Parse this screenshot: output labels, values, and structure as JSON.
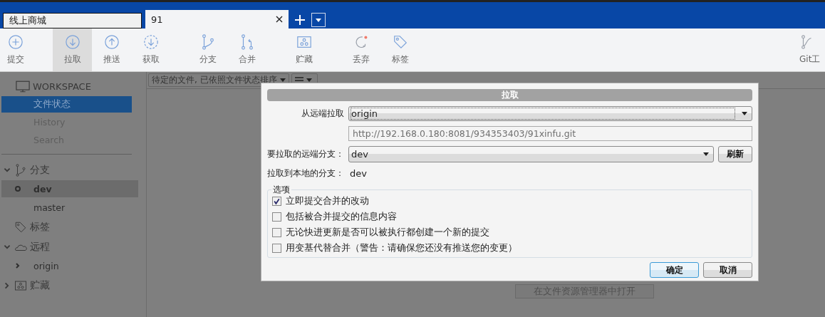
{
  "tabs": [
    {
      "label": "线上商城",
      "selected": false
    },
    {
      "label": "91",
      "selected": true
    }
  ],
  "toolbar": [
    {
      "label": "提交",
      "selected": false
    },
    {
      "label": "拉取",
      "selected": true
    },
    {
      "label": "推送",
      "selected": false
    },
    {
      "label": "获取",
      "selected": false
    },
    {
      "label": "分支",
      "selected": false
    },
    {
      "label": "合并",
      "selected": false
    },
    {
      "label": "贮藏",
      "selected": false
    },
    {
      "label": "丢弃",
      "selected": false
    },
    {
      "label": "标签",
      "selected": false
    }
  ],
  "toolbar_right": {
    "label": "Git工"
  },
  "sidebar": {
    "workspace": {
      "title": "WORKSPACE",
      "items": [
        {
          "label": "文件状态",
          "selected": true
        },
        {
          "label": "History",
          "selected": false
        },
        {
          "label": "Search",
          "selected": false
        }
      ]
    },
    "sections": [
      {
        "title": "分支",
        "expanded": true,
        "items": [
          {
            "label": "dev",
            "selected": true
          },
          {
            "label": "master",
            "selected": false
          }
        ]
      },
      {
        "title": "标签"
      },
      {
        "title": "远程",
        "expanded": true,
        "items": [
          {
            "label": "origin",
            "selected": false,
            "expanded": false
          }
        ]
      },
      {
        "title": "贮藏",
        "expanded": false
      }
    ]
  },
  "file_filter": {
    "value": "待定的文件, 已依照文件状态排序"
  },
  "open_in_explorer": "在文件资源管理器中打开",
  "dialog": {
    "title": "拉取",
    "remote": {
      "label": "从远端拉取",
      "value": "origin"
    },
    "url": "http://192.168.0.180:8081/934353403/91xinfu.git",
    "remote_branch": {
      "label": "要拉取的远端分支：",
      "value": "dev"
    },
    "refresh": "刷新",
    "local_branch": {
      "label": "拉取到本地的分支：",
      "value": "dev"
    },
    "options": {
      "legend": "选项",
      "items": [
        {
          "label": "立即提交合并的改动",
          "checked": true
        },
        {
          "label": "包括被合并提交的信息内容",
          "checked": false
        },
        {
          "label": "无论快进更新是否可以被执行都创建一个新的提交",
          "checked": false
        },
        {
          "label": "用变基代替合并（警告：请确保您还没有推送您的变更）",
          "checked": false
        }
      ]
    },
    "buttons": [
      {
        "label": "确定",
        "default": true
      },
      {
        "label": "取消",
        "default": false
      }
    ]
  }
}
